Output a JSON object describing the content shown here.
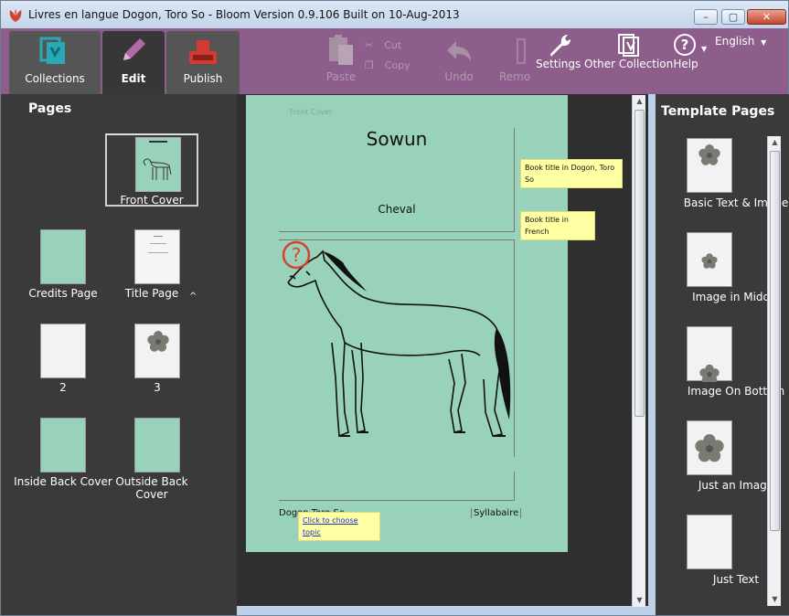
{
  "window": {
    "title": "Livres en langue Dogon, Toro So - Bloom Version 0.9.106 Built on 10-Aug-2013",
    "minimize_glyph": "–",
    "maximize_glyph": "▢",
    "close_glyph": "✕"
  },
  "tabs": {
    "collections": "Collections",
    "edit": "Edit",
    "publish": "Publish"
  },
  "toolbar": {
    "paste": "Paste",
    "cut": "Cut",
    "copy": "Copy",
    "undo": "Undo",
    "remove": "Remo",
    "settings": "Settings",
    "other_collection": "Other Collection",
    "help": "Help",
    "language": "English"
  },
  "pages_panel": {
    "title": "Pages",
    "items": [
      {
        "label": "Front Cover"
      },
      {
        "label": "Credits Page"
      },
      {
        "label": "Title Page"
      },
      {
        "label": "2"
      },
      {
        "label": "3"
      },
      {
        "label": "Inside Back Cover"
      },
      {
        "label": "Outside Back Cover"
      }
    ],
    "caret": "^"
  },
  "editor": {
    "page_label": "Front Cover",
    "book_title": "Sowun",
    "translated_title": "Cheval",
    "bottom_left": "Dogon Toro So",
    "bottom_right": "Syllabaire",
    "question_mark": "?",
    "notes": {
      "title_dogon": "Book title in Dogon, Toro So",
      "title_french": "Book title in French",
      "topic": "Click to choose topic"
    }
  },
  "template_panel": {
    "title": "Template Pages",
    "items": [
      {
        "label": "Basic Text & Image"
      },
      {
        "label": "Image in Middle"
      },
      {
        "label": "Image On Bottom"
      },
      {
        "label": "Just an Image"
      },
      {
        "label": "Just Text"
      }
    ]
  },
  "colors": {
    "toolbar": "#8d5d8b",
    "panel": "#3a3a3a",
    "page": "#98d2bb",
    "note": "#ffffa3",
    "flower": "#7a7a72"
  }
}
